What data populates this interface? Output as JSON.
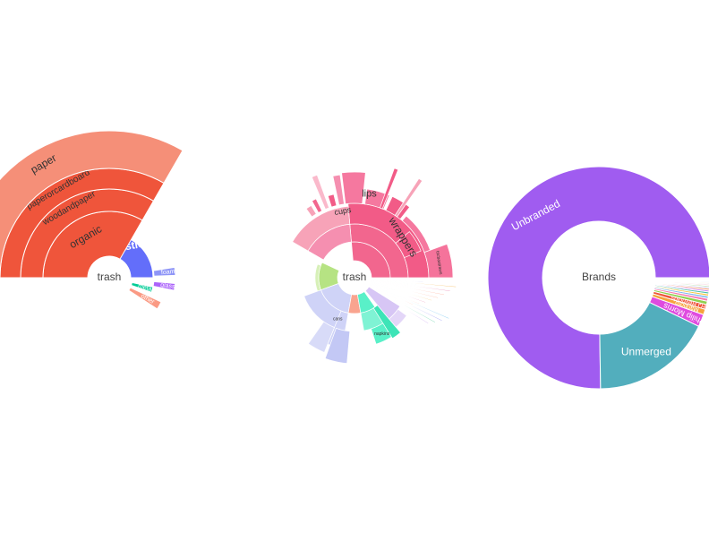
{
  "chart_data": [
    {
      "type": "sunburst",
      "root": "trash",
      "rings": [
        [
          {
            "name": "plastic",
            "start": -120,
            "end": 0,
            "color": "#636efa",
            "text_color": "#ffffff",
            "label_size": 12
          },
          {
            "name": "organic",
            "start": 180,
            "end": 300,
            "color": "#ef553b",
            "text_color": "#333333",
            "label_size": 12
          }
        ],
        [
          {
            "name": "woodandpaper",
            "start": 180,
            "end": 300,
            "color": "#ef553b",
            "text_color": "#333333",
            "label_size": 10
          }
        ],
        [
          {
            "name": "paperorcardboard",
            "start": 180,
            "end": 300,
            "color": "#ef553b",
            "text_color": "#333333",
            "label_size": 10
          }
        ],
        [
          {
            "name": "paper",
            "start": 180,
            "end": 300,
            "color": "#f58f78",
            "text_color": "#333333",
            "label_size": 12
          }
        ]
      ],
      "outer_small": [
        {
          "name": "foam",
          "start": -9,
          "end": -2,
          "r0": 50,
          "r1": 74,
          "color": "#8e95f7"
        },
        {
          "name": "glass",
          "start": 5,
          "end": 11,
          "r0": 50,
          "r1": 74,
          "color": "#ab63fa"
        },
        {
          "name": "metal",
          "start": 12,
          "end": 19,
          "r0": 26,
          "r1": 50,
          "color": "#00cc96"
        },
        {
          "name": "other",
          "start": 25,
          "end": 33,
          "r0": 26,
          "r1": 64,
          "color": "#fa9a84"
        }
      ]
    },
    {
      "type": "sunburst",
      "root": "trash",
      "labels": [
        "cups",
        "lips",
        "wrappers",
        "tscbastraws",
        "napkins",
        "cans"
      ]
    },
    {
      "type": "donut",
      "title": "Brands",
      "slices": [
        {
          "name": "Unbranded",
          "value": 75.0,
          "color": "#a05cf0"
        },
        {
          "name": "Unmerged",
          "value": 17.5,
          "color": "#52aebd"
        },
        {
          "name": "Philip Morris",
          "value": 1.8,
          "color": "#df4bdf"
        },
        {
          "name": "Marlboro",
          "value": 0.8,
          "color": "#f6a23d"
        },
        {
          "name": "RJ Reynolds",
          "value": 0.7,
          "color": "#ef553b"
        },
        {
          "name": "",
          "value": 0.5,
          "color": "#8fd14f"
        },
        {
          "name": "",
          "value": 0.4,
          "color": "#f87ab0"
        },
        {
          "name": "",
          "value": 0.35,
          "color": "#7eb6f0"
        },
        {
          "name": "",
          "value": 0.3,
          "color": "#f4c542"
        },
        {
          "name": "",
          "value": 0.3,
          "color": "#4bc0a8"
        },
        {
          "name": "",
          "value": 0.25,
          "color": "#c47ef0"
        },
        {
          "name": "",
          "value": 0.25,
          "color": "#f28e6b"
        },
        {
          "name": "",
          "value": 0.2,
          "color": "#9aa7f7"
        },
        {
          "name": "",
          "value": 0.2,
          "color": "#b5dfa8"
        },
        {
          "name": "",
          "value": 0.2,
          "color": "#f6c6d6"
        },
        {
          "name": "",
          "value": 0.15,
          "color": "#d8d8d8"
        },
        {
          "name": "",
          "value": 0.15,
          "color": "#f0b27a"
        },
        {
          "name": "",
          "value": 0.15,
          "color": "#a3c1f5"
        },
        {
          "name": "",
          "value": 0.12,
          "color": "#d3a6f5"
        },
        {
          "name": "",
          "value": 0.1,
          "color": "#cccccc"
        },
        {
          "name": "",
          "value": 0.1,
          "color": "#e0e0e0"
        },
        {
          "name": "",
          "value": 0.08,
          "color": "#e6e6e6"
        },
        {
          "name": "",
          "value": 0.08,
          "color": "#ececec"
        }
      ]
    }
  ]
}
